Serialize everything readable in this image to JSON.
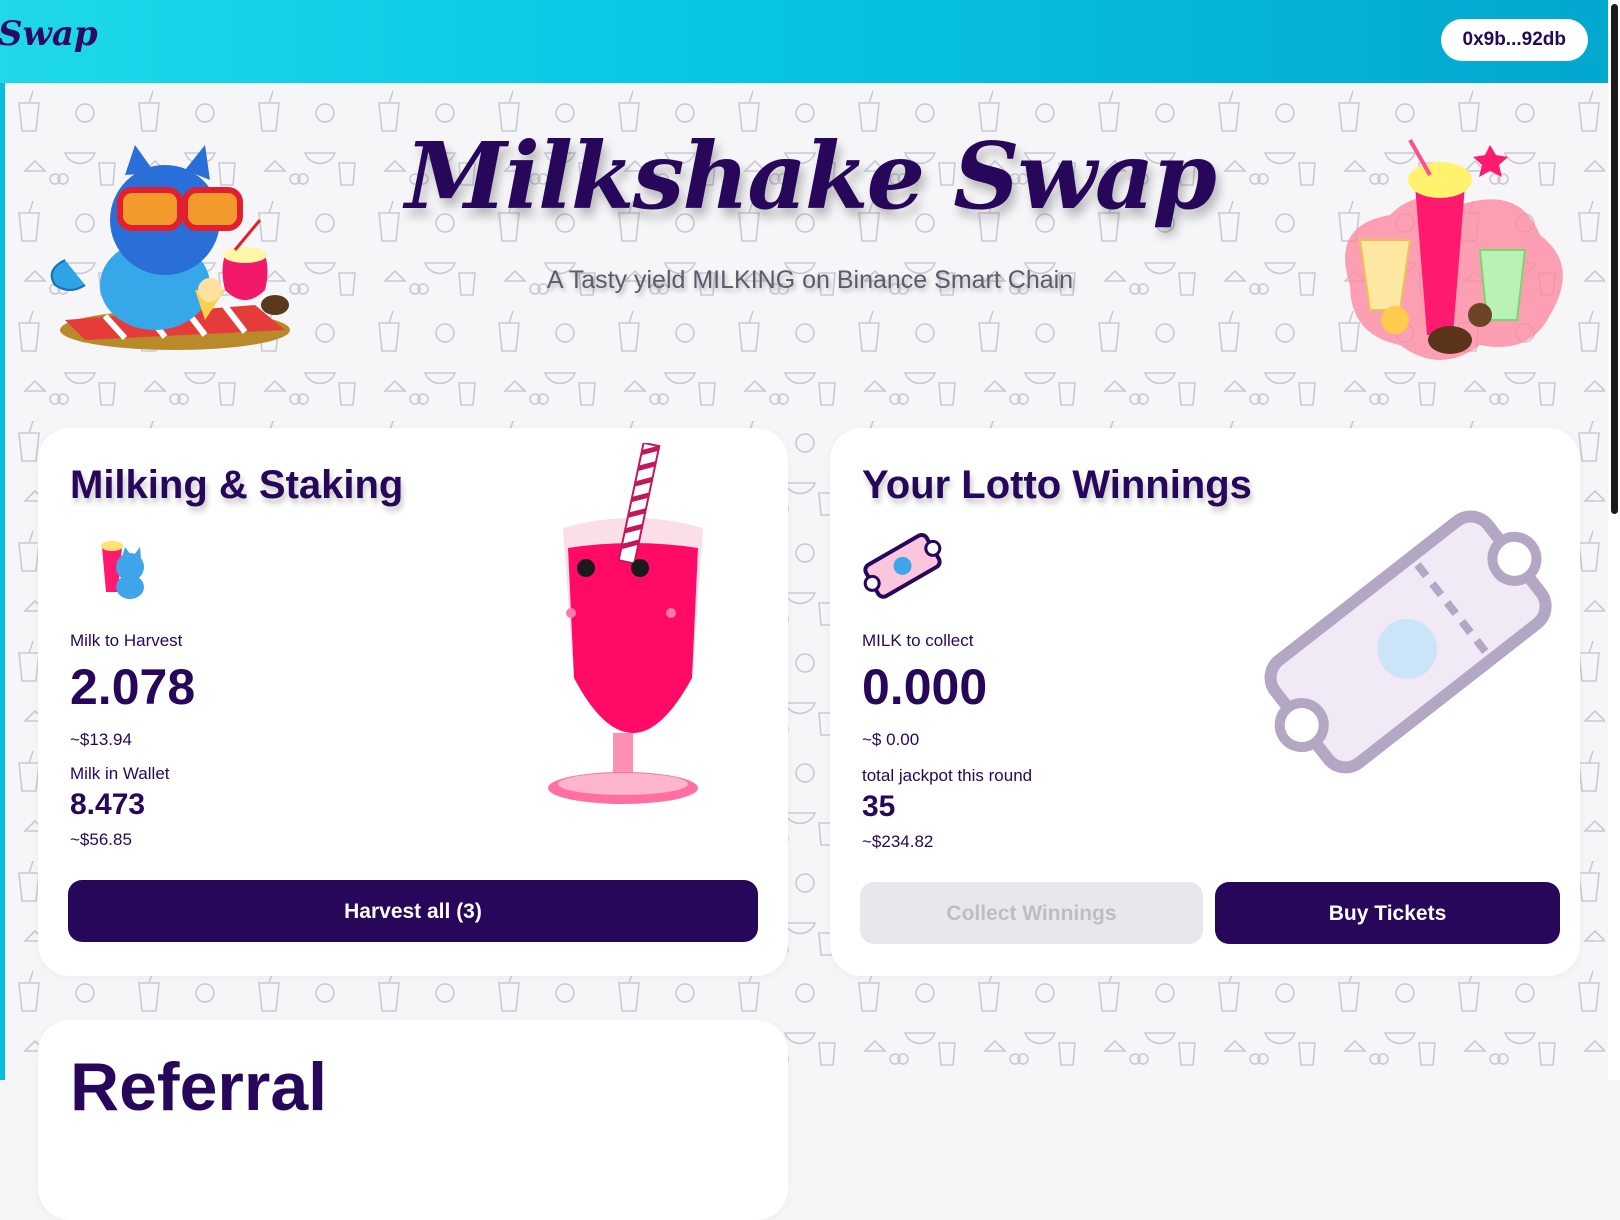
{
  "header": {
    "brand": "Swap",
    "wallet_address": "0x9b...92db"
  },
  "hero": {
    "title": "Milkshake Swap",
    "subtitle": "A Tasty yield MILKING on Binance Smart Chain"
  },
  "staking_card": {
    "title": "Milking & Staking",
    "harvest_label": "Milk to Harvest",
    "harvest_value": "2.078",
    "harvest_usd": "~$13.94",
    "wallet_label": "Milk in Wallet",
    "wallet_value": "8.473",
    "wallet_usd": "~$56.85",
    "harvest_button": "Harvest all (3)"
  },
  "lotto_card": {
    "title": "Your Lotto Winnings",
    "collect_label": "MILK to collect",
    "collect_value": "0.000",
    "collect_usd": "~$ 0.00",
    "jackpot_label": "total jackpot this round",
    "jackpot_value": "35",
    "jackpot_usd": "~$234.82",
    "collect_button": "Collect Winnings",
    "buy_button": "Buy Tickets"
  },
  "referral_card": {
    "title": "Referral"
  },
  "colors": {
    "primary": "#27075a",
    "header_cyan": "#08c8e4",
    "milkshake_pink": "#ff0a66"
  }
}
